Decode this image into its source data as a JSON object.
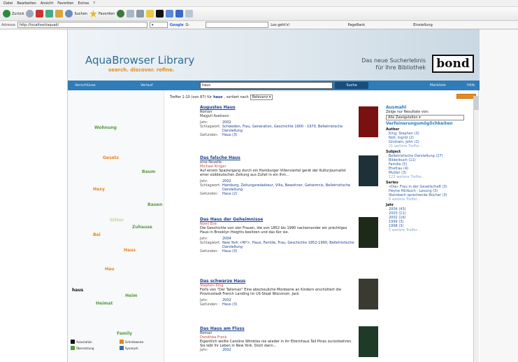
{
  "browser": {
    "menu": [
      "Datei",
      "Bearbeiten",
      "Ansicht",
      "Favoriten",
      "Extras",
      "?"
    ],
    "toolbar": {
      "back": "Zurück",
      "search": "Suchen",
      "favorites": "Favoriten",
      "google": "Google",
      "google_go": "G-",
      "los": "Los geht's!",
      "pagerank": "PageRank",
      "einstellungen": "Einstellung"
    },
    "address_label": "Adresse",
    "address": "http://localhost/aquali/"
  },
  "site": {
    "logo_title": "AquaBrowser Library",
    "logo_tagline": "search. discover. refine.",
    "slogan_1": "Das neue Sucherlebnis",
    "slogan_2": "für Ihre Bibliothek",
    "brand": "bond",
    "nav": {
      "tab_1": "Verschlüsse",
      "tab_2": "Verlauf",
      "search_value": "haus",
      "search_button": "Suche",
      "merkliste": "Merkliste",
      "hilfe": "Hilfe"
    },
    "cloud": [
      {
        "word": "Wohnung",
        "color": "#5a9a3c"
      },
      {
        "word": "Gesetz",
        "color": "#e8821a"
      },
      {
        "word": "Baum",
        "color": "#5a9a3c"
      },
      {
        "word": "Hexy",
        "color": "#e8821a"
      },
      {
        "word": "Bauen",
        "color": "#5a9a3c"
      },
      {
        "word": "Gitter",
        "color": "#c6d6a8"
      },
      {
        "word": "Zuhause",
        "color": "#5a9a3c"
      },
      {
        "word": "Bei",
        "color": "#e8821a"
      },
      {
        "word": "Haus",
        "color": "#e8821a"
      },
      {
        "word": "Hau",
        "color": "#e8821a"
      },
      {
        "word": "haus",
        "color": "#111111"
      },
      {
        "word": "Heim",
        "color": "#5a9a3c"
      },
      {
        "word": "Heimat",
        "color": "#5a9a3c"
      },
      {
        "word": "Family",
        "color": "#5a9a3c"
      }
    ],
    "legend": [
      {
        "label": "Assoziation",
        "color": "#111111"
      },
      {
        "label": "Schreibweise",
        "color": "#e8821a"
      },
      {
        "label": "Übersetzung",
        "color": "#5a9a3c"
      },
      {
        "label": "Synonym",
        "color": "#2f6fb0"
      }
    ],
    "results_info": {
      "prefix": "Treffer 1-10 (von 87) für",
      "term": "haus",
      "suffix": ", sortiert nach",
      "sort": "Relevanz"
    },
    "results": [
      {
        "title": "Augustes Haus",
        "subtitle": "Roman",
        "author": "Majgull Axelsson",
        "desc": "",
        "rows": [
          {
            "k": "Jahr:",
            "v": "2002"
          },
          {
            "k": "Schlagwort:",
            "v": "Schweden, Frau, Generation, Geschichte 1900 - 1970, Belletristische Darstellung"
          },
          {
            "k": "Gefunden:",
            "v": "Haus (3)"
          }
        ],
        "cover": "#7a1010"
      },
      {
        "title": "Das falsche Haus",
        "subtitle": "eine Novelle",
        "author": "Michael Krüger",
        "desc": "Auf einem Spaziergang durch ein Hamburger Villenviertel gerät der Kulturjournalist einer süddeutschen Zeitung aus Zufall in ein Ihm...",
        "rows": [
          {
            "k": "Jahr:",
            "v": "2002"
          },
          {
            "k": "Schlagwort:",
            "v": "Hamburg, Zeitungsredakteur, Villa, Bewohner, Geheimnis, Belletristische Darstellung"
          },
          {
            "k": "Gefunden:",
            "v": "Haus (2)"
          }
        ],
        "cover": "#1e3038"
      },
      {
        "title": "Das Haus der Geheimnisse",
        "subtitle": "",
        "author": "Nomi Eve",
        "desc": "Die Geschichte von vier Frauen, die von 1852 bis 1990 nacheinander ein prächtiges Haus in Brooklyn Heights besitzen und das Kor sie.",
        "rows": [
          {
            "k": "Jahr:",
            "v": "2004"
          },
          {
            "k": "Schlagwort:",
            "v": "New York <NY>, Haus, Familie, Frau, Geschichte 1852-1990, Belletristische Darstellung"
          },
          {
            "k": "Gefunden:",
            "v": "Haus (3)"
          }
        ],
        "cover": "#1d2a18"
      },
      {
        "title": "Das schwarze Haus",
        "subtitle": "",
        "author": "Stephen King",
        "desc": "Forts von \"Der Talisman\" Eine abscheuliche Mordserie an Kindern erschüttert die Provinzstadt French Landing im US-Staat Wisconsin. Jack",
        "rows": [
          {
            "k": "Jahr:",
            "v": "2002"
          },
          {
            "k": "Gefunden:",
            "v": "Haus (3)"
          }
        ],
        "cover": "#3a3a30"
      },
      {
        "title": "Das Haus am Fluss",
        "subtitle": "Roman",
        "author": "Dorothea Frank",
        "desc": "Eigentlich wollte Caroline Wimbles nie wieder in ihr Elternhaus Tall Pines zurückkehren. Sie lebt ihr Leben in New York. Doch dann...",
        "rows": [
          {
            "k": "Jahr:",
            "v": "2002"
          }
        ],
        "cover": "#1f3a26"
      }
    ],
    "facets": {
      "title": "Ausmahl",
      "show_label": "Zeige nur Resultate von:",
      "show_value": "Alle Zweigstellen",
      "refine_title": "Verfeinerungsmöglichkeiten",
      "author_title": "Author",
      "authors": [
        "King, Stephen (3)",
        "Noll, Ingrid (2)",
        "Grisham, John (2)",
        "21 weitere Treffer..."
      ],
      "subject_title": "Subject",
      "subjects": [
        "Belletristische Darstellung (27)",
        "Bilderbuch (11)",
        "Familie (5)",
        "Ehefrau (4)",
        "Mutter (3)",
        "122 weitere Treffer..."
      ],
      "series_title": "Series",
      "series": [
        "«Die» Frau in der Gesellschaft (3)",
        "Heyne Hörbuch ; Lesung (3)",
        "Steinbach sprechende Bücher (3)",
        "6 weitere Treffer..."
      ],
      "year_title": "Jahr",
      "years": [
        "2004 (43)",
        "2003 (11)",
        "2002 (16)",
        "1999 (3)",
        "1998 (3)",
        "5 weitere Treffer..."
      ]
    }
  }
}
